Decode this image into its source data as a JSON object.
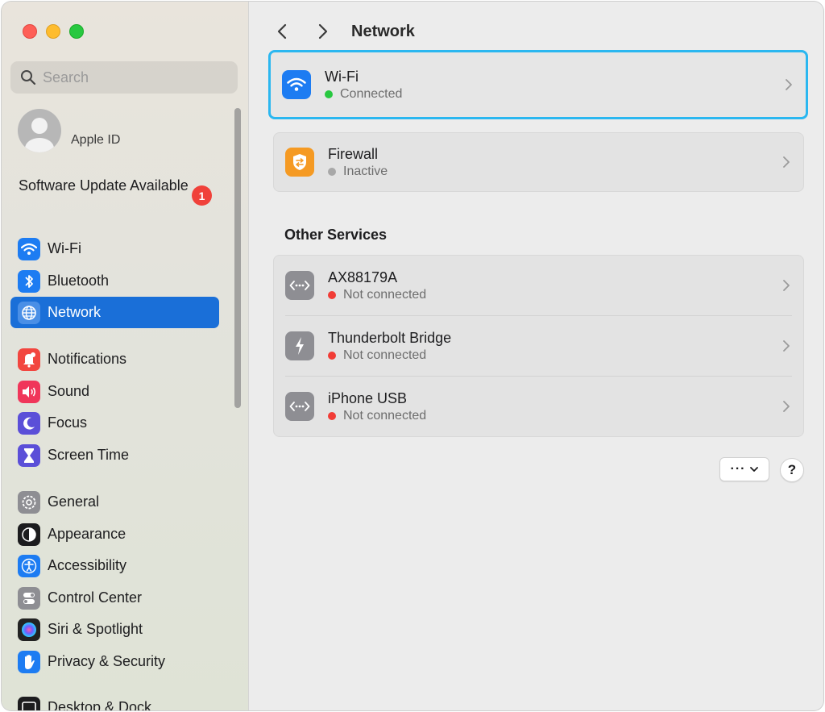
{
  "window": {
    "title": "Network"
  },
  "sidebar": {
    "search": {
      "placeholder": "Search",
      "value": ""
    },
    "apple_id": {
      "label": "Apple ID"
    },
    "software_update": {
      "label": "Software Update Available",
      "badge": "1"
    },
    "items": [
      {
        "label": "Wi-Fi",
        "icon": "wifi-icon",
        "color": "#1d7cf2"
      },
      {
        "label": "Bluetooth",
        "icon": "bluetooth-icon",
        "color": "#1d7cf2"
      },
      {
        "label": "Network",
        "icon": "globe-icon",
        "color": "#1d7cf2",
        "selected": true
      },
      {
        "label": "Notifications",
        "icon": "bell-icon",
        "color": "#f2463f"
      },
      {
        "label": "Sound",
        "icon": "speaker-icon",
        "color": "#f0365a"
      },
      {
        "label": "Focus",
        "icon": "moon-icon",
        "color": "#5b4fd8"
      },
      {
        "label": "Screen Time",
        "icon": "hourglass-icon",
        "color": "#5b4fd8"
      },
      {
        "label": "General",
        "icon": "gear-icon",
        "color": "#8e8e93"
      },
      {
        "label": "Appearance",
        "icon": "appearance-icon",
        "color": "#1c1c1e"
      },
      {
        "label": "Accessibility",
        "icon": "accessibility-icon",
        "color": "#1d7cf2"
      },
      {
        "label": "Control Center",
        "icon": "control-center-icon",
        "color": "#8e8e93"
      },
      {
        "label": "Siri & Spotlight",
        "icon": "siri-icon",
        "color": "#222"
      },
      {
        "label": "Privacy & Security",
        "icon": "hand-icon",
        "color": "#1d7cf2"
      },
      {
        "label": "Desktop & Dock",
        "icon": "dock-icon",
        "color": "#1c1c1e"
      }
    ]
  },
  "main": {
    "title": "Network",
    "services": [
      {
        "name": "Wi-Fi",
        "status": "Connected",
        "status_color": "#28c840",
        "icon": "wifi-icon",
        "icon_color": "#1d7cf2"
      },
      {
        "name": "Firewall",
        "status": "Inactive",
        "status_color": "#a8a8a8",
        "icon": "firewall-shield-icon",
        "icon_color": "#f59a23"
      }
    ],
    "other_services_heading": "Other Services",
    "other_services": [
      {
        "name": "AX88179A",
        "status": "Not connected",
        "status_color": "#f13c36",
        "icon": "ethernet-icon"
      },
      {
        "name": "Thunderbolt Bridge",
        "status": "Not connected",
        "status_color": "#f13c36",
        "icon": "thunderbolt-icon"
      },
      {
        "name": "iPhone USB",
        "status": "Not connected",
        "status_color": "#f13c36",
        "icon": "ethernet-icon"
      }
    ],
    "more_button": "···",
    "help_button": "?"
  }
}
